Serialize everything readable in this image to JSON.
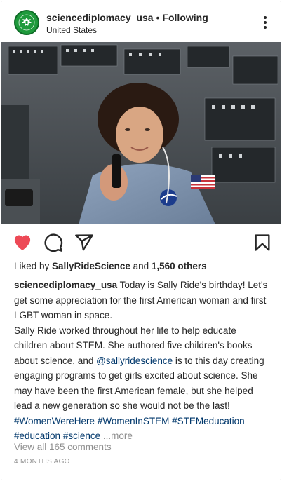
{
  "post": {
    "username": "sciencediplomacy_usa",
    "separator": "•",
    "follow_label": "Following",
    "location": "United States",
    "icons": {
      "avatar": "eagle-seal-avatar",
      "more": "more-options-icon",
      "like": "heart-icon",
      "comment": "comment-icon",
      "share": "share-icon",
      "save": "bookmark-icon"
    },
    "liked": true,
    "like_color": "#ed4956"
  },
  "likes": {
    "prefix": "Liked by ",
    "user": "SallyRideScience",
    "middle": " and ",
    "others": "1,560 others"
  },
  "caption": {
    "username": "sciencediplomacy_usa",
    "line1": " Today is Sally Ride's birthday! Let's get some appreciation for the first American woman and first LGBT woman in space.",
    "line2a": "Sally Ride worked throughout her life to help educate children about STEM. She authored five children's books about science, and ",
    "mention": "@sallyridescience",
    "line2b": " is to this day creating engaging programs to get girls excited about science. She may have been the first American female, but she helped lead a new generation so she would not be the last!",
    "hashtags": [
      "#WomenWereHere",
      "#WomenInSTEM",
      "#STEMeducation",
      "#education",
      "#science"
    ],
    "more_label": "...more"
  },
  "comments": {
    "view_all": "View all 165 comments"
  },
  "timestamp": "4 MONTHS AGO"
}
